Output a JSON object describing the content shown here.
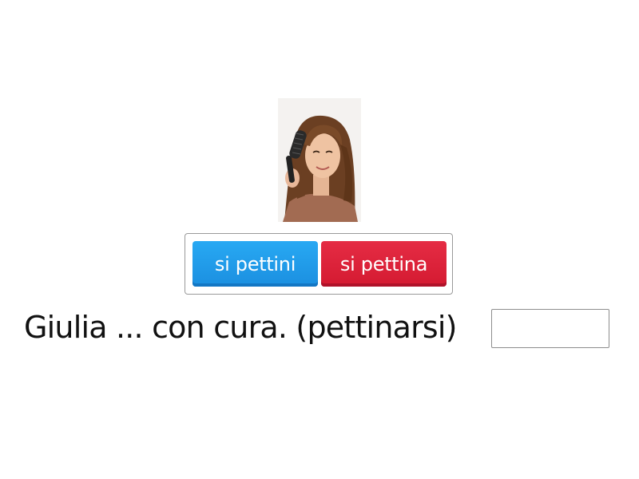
{
  "image": {
    "subject": "girl-brushing-hair-photo"
  },
  "choices": [
    {
      "label": "si pettini",
      "color": "#1b8fe0"
    },
    {
      "label": "si pettina",
      "color": "#d41a31"
    }
  ],
  "question": {
    "text": "Giulia ... con cura. (pettinarsi)"
  },
  "answer": {
    "value": ""
  }
}
